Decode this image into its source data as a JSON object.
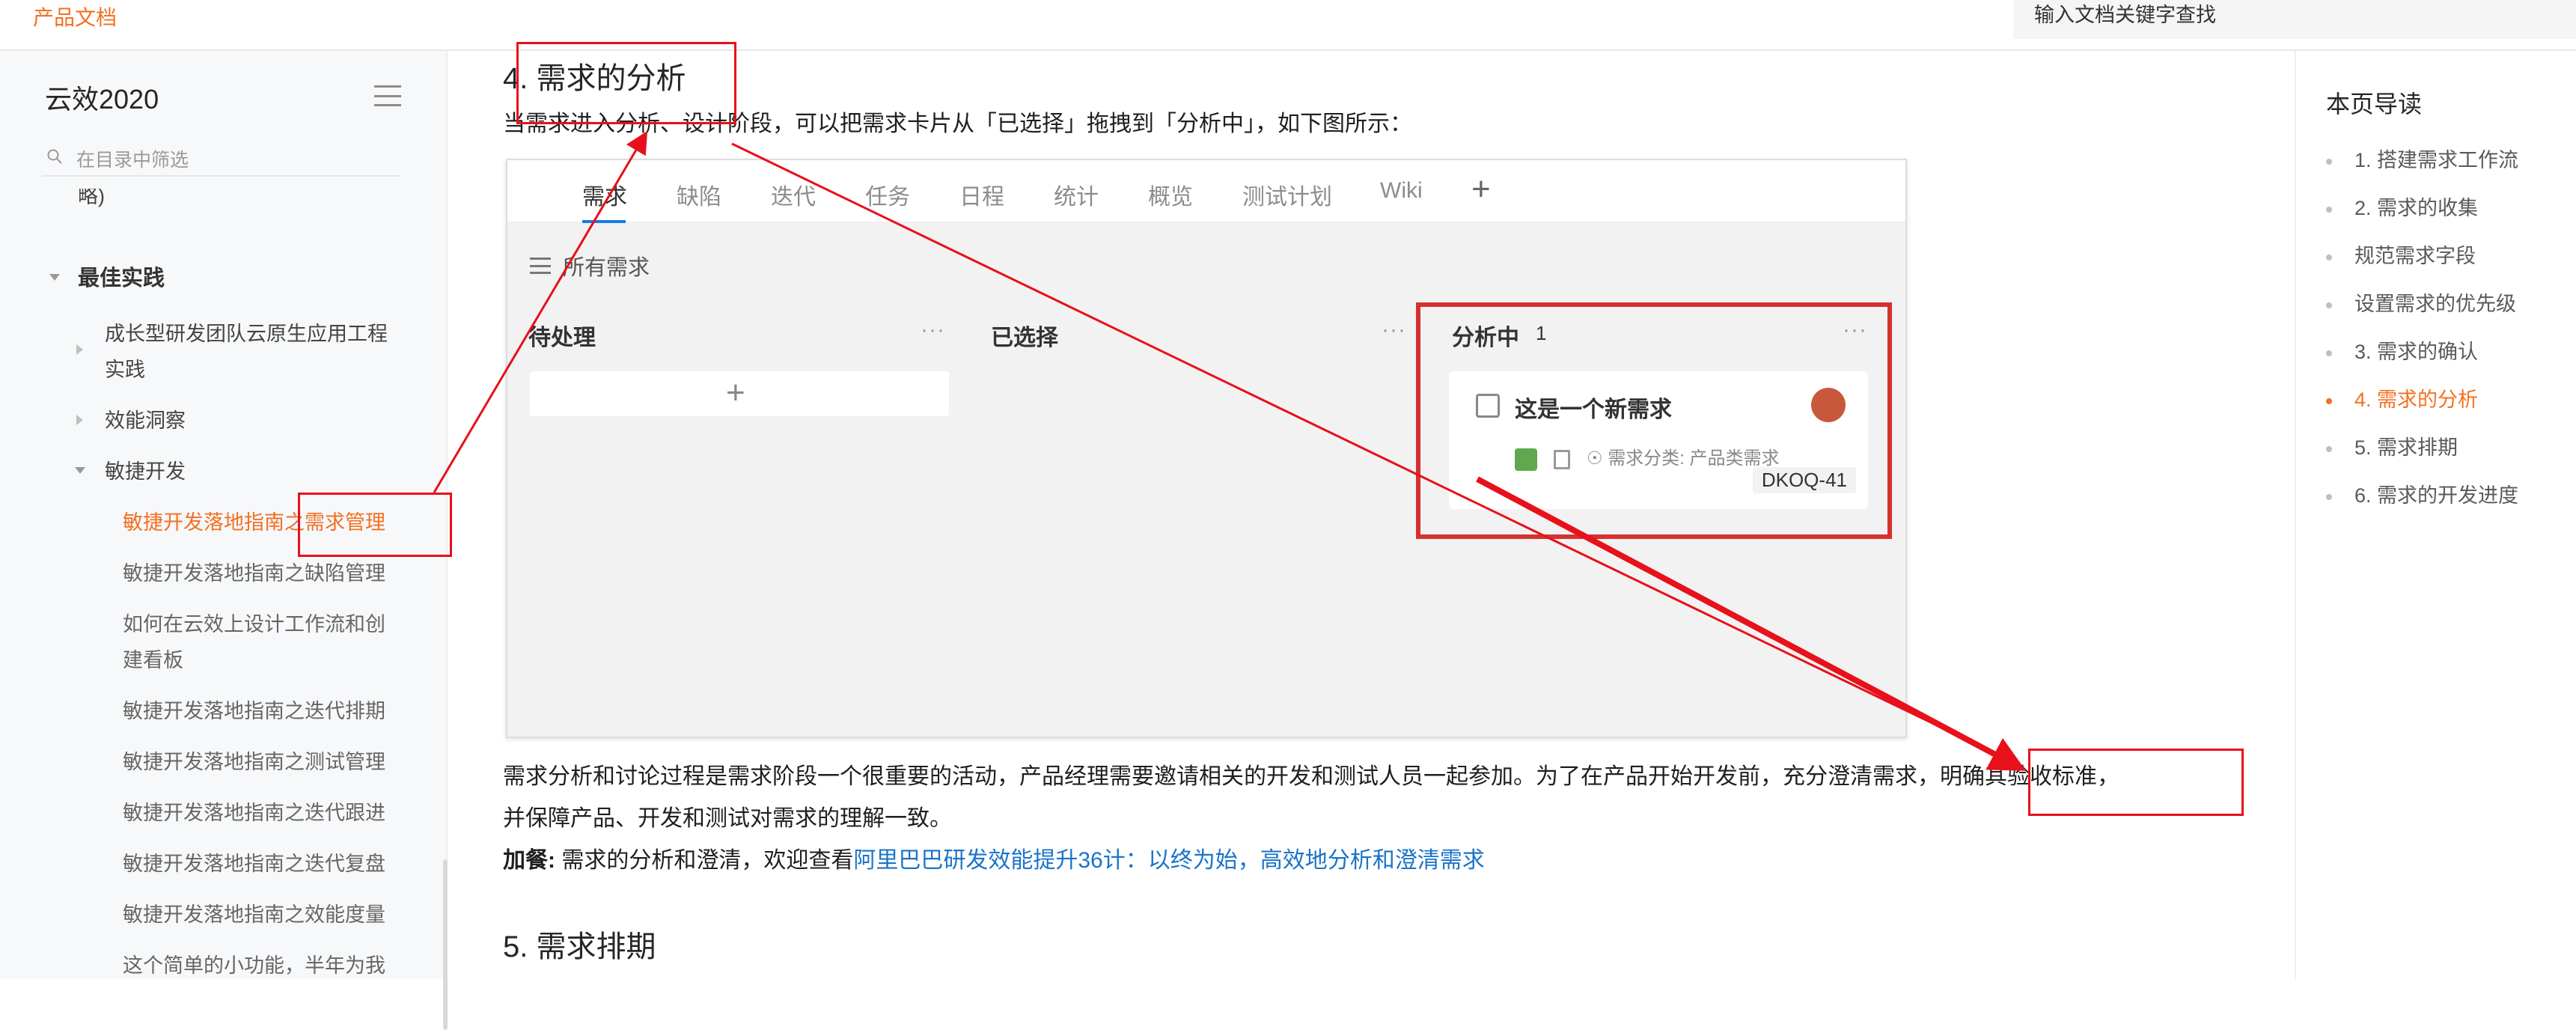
{
  "topbar": {
    "brand": "产品文档",
    "search_placeholder": "输入文档关键字查找"
  },
  "sidebar": {
    "title": "云效2020",
    "filter_placeholder": "在目录中筛选",
    "partial_item": "略)",
    "best_practice": "最佳实践",
    "items": [
      {
        "label": "成长型研发团队云原生应用工程",
        "label2": "实践"
      },
      {
        "label": "效能洞察"
      },
      {
        "label": "敏捷开发"
      }
    ],
    "sub_items": [
      {
        "label": "敏捷开发落地指南之需求管理",
        "active": true
      },
      {
        "label": "敏捷开发落地指南之缺陷管理"
      },
      {
        "label": "如何在云效上设计工作流和创",
        "label2": "建看板"
      },
      {
        "label": "敏捷开发落地指南之迭代排期"
      },
      {
        "label": "敏捷开发落地指南之测试管理"
      },
      {
        "label": "敏捷开发落地指南之迭代跟进"
      },
      {
        "label": "敏捷开发落地指南之迭代复盘"
      },
      {
        "label": "敏捷开发落地指南之效能度量"
      },
      {
        "label": "这个简单的小功能，半年为我"
      }
    ]
  },
  "main": {
    "section4_title": "4. 需求的分析",
    "intro": "当需求进入分析、设计阶段，可以把需求卡片从「已选择」拖拽到「分析中」，如下图所示：",
    "screenshot": {
      "tabs": [
        "需求",
        "缺陷",
        "迭代",
        "任务",
        "日程",
        "统计",
        "概览",
        "测试计划",
        "Wiki"
      ],
      "plus": "+",
      "all_requirements": "所有需求",
      "columns": [
        {
          "title": "待处理",
          "dots": "···"
        },
        {
          "title": "已选择",
          "dots": "···"
        },
        {
          "title": "分析中",
          "count": "1",
          "dots": "···"
        }
      ],
      "add_card": "+",
      "card": {
        "title": "这是一个新需求",
        "category": "需求分类: 产品类需求",
        "id": "DKOQ-41"
      }
    },
    "para1_line1": "需求分析和讨论过程是需求阶段一个很重要的活动，产品经理需要邀请相关的开发和测试人员一起参加。为了在产品开始开发前，充分澄清需求，明确其验收标准，",
    "para1_line2": "并保障产品、开发和测试对需求的理解一致。",
    "extra_label": "加餐:",
    "extra_text": " 需求的分析和澄清，欢迎查看",
    "extra_link": "阿里巴巴研发效能提升36计：以终为始，高效地分析和澄清需求",
    "section5_title": "5. 需求排期"
  },
  "toc": {
    "title": "本页导读",
    "items": [
      {
        "label": "1. 搭建需求工作流"
      },
      {
        "label": "2. 需求的收集"
      },
      {
        "label": "规范需求字段"
      },
      {
        "label": "设置需求的优先级"
      },
      {
        "label": "3. 需求的确认"
      },
      {
        "label": "4. 需求的分析",
        "active": true
      },
      {
        "label": "5. 需求排期"
      },
      {
        "label": "6. 需求的开发进度"
      }
    ]
  },
  "colors": {
    "accent": "#f37021",
    "annotation": "#e8101a",
    "link": "#1a73c9"
  }
}
